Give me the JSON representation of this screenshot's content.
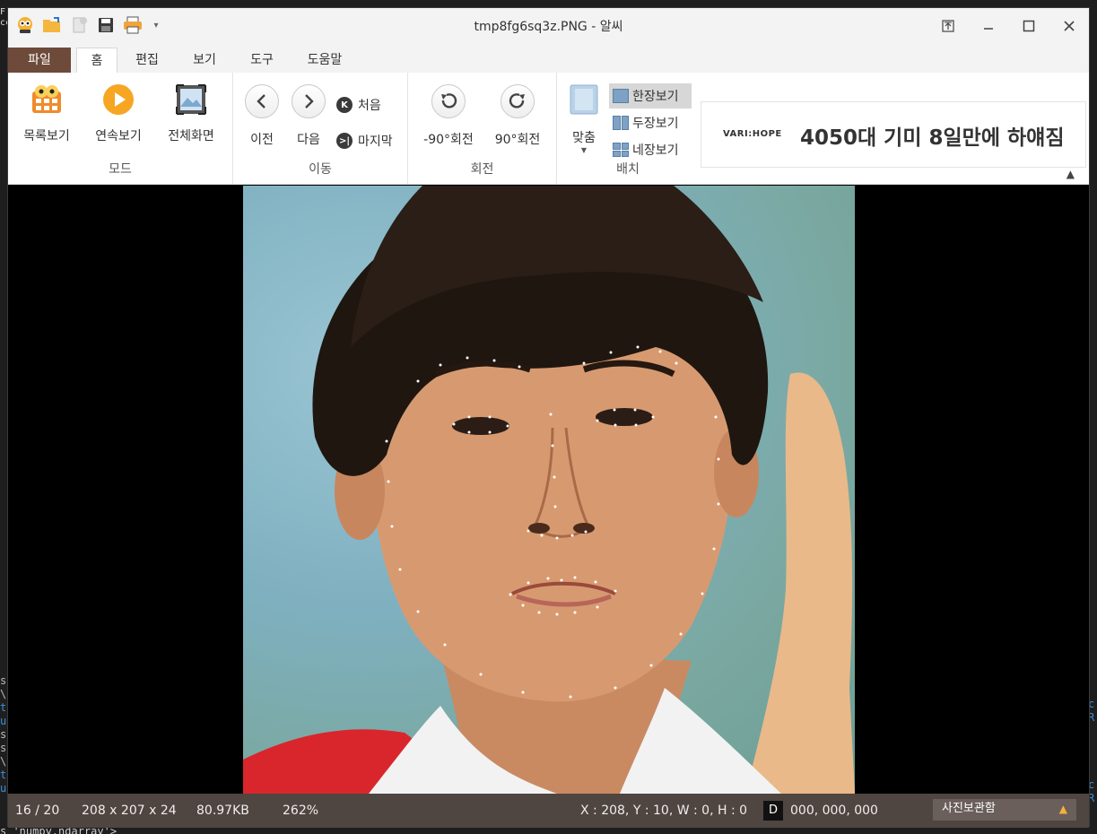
{
  "app": {
    "title": "tmp8fg6sq3z.PNG - 알씨"
  },
  "menu_tabs": [
    {
      "label": "파일"
    },
    {
      "label": "홈"
    },
    {
      "label": "편집"
    },
    {
      "label": "보기"
    },
    {
      "label": "도구"
    },
    {
      "label": "도움말"
    }
  ],
  "ribbon": {
    "mode": {
      "label": "모드",
      "list_view": "목록보기",
      "slideshow": "연속보기",
      "fullscreen": "전체화면"
    },
    "move": {
      "label": "이동",
      "prev": "이전",
      "next": "다음",
      "first": "처음",
      "last": "마지막"
    },
    "rotate": {
      "label": "회전",
      "ccw": "-90°회전",
      "cw": "90°회전"
    },
    "layout": {
      "label": "배치",
      "fit": "맞춤",
      "single": "한장보기",
      "double": "두장보기",
      "quad": "네장보기"
    }
  },
  "ad": {
    "logo": "VARI:HOPE",
    "text": "4050대 기미 8일만에 하얘짐"
  },
  "status": {
    "index": "16 / 20",
    "dimensions": "208 x 207 x 24",
    "filesize": "80.97KB",
    "zoom": "262%",
    "coords": "X : 208, Y : 10, W : 0, H : 0",
    "mode_letter": "D",
    "color_value": "000, 000, 000",
    "album": "사진보관함"
  },
  "background_terminal": {
    "bottom_line": "s 'numpy.ndarray'>",
    "left_chars": [
      "s",
      "\\",
      "t",
      "u",
      "s",
      "s",
      "\\",
      "t",
      "u"
    ],
    "right_chars": [
      "c",
      "R",
      "c",
      "R"
    ],
    "top_left": [
      "F",
      "cc"
    ]
  }
}
